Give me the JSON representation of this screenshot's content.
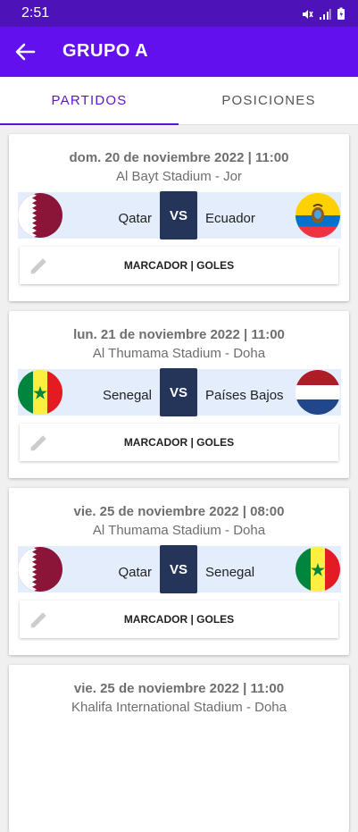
{
  "status_bar": {
    "time": "2:51"
  },
  "app_bar": {
    "title": "GRUPO A"
  },
  "tabs": [
    {
      "label": "PARTIDOS",
      "active": true
    },
    {
      "label": "POSICIONES",
      "active": false
    }
  ],
  "matches": [
    {
      "date": "dom. 20 de noviembre 2022 | 11:00",
      "venue": "Al Bayt Stadium - Jor",
      "home": "Qatar",
      "away": "Ecuador",
      "home_flag": "qatar-flag",
      "away_flag": "ecuador-flag",
      "vs": "VS",
      "score_label": "MARCADOR | GOLES"
    },
    {
      "date": "lun. 21 de noviembre 2022 | 11:00",
      "venue": "Al Thumama Stadium - Doha",
      "home": "Senegal",
      "away": "Países Bajos",
      "home_flag": "senegal-flag",
      "away_flag": "netherlands-flag",
      "vs": "VS",
      "score_label": "MARCADOR | GOLES"
    },
    {
      "date": "vie. 25 de noviembre 2022 | 08:00",
      "venue": "Al Thumama Stadium - Doha",
      "home": "Qatar",
      "away": "Senegal",
      "home_flag": "qatar-flag",
      "away_flag": "senegal-flag",
      "vs": "VS",
      "score_label": "MARCADOR | GOLES"
    },
    {
      "date": "vie. 25 de noviembre 2022 | 11:00",
      "venue": "Khalifa International Stadium - Doha"
    }
  ],
  "colors": {
    "status_bar": "#4d12b8",
    "app_bar": "#6210ee",
    "accent": "#5a14d8",
    "vs_box": "#243559",
    "match_row": "#e3edfb"
  }
}
